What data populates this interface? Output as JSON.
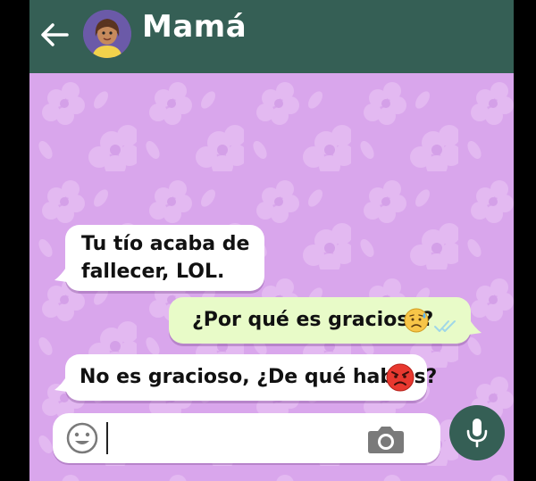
{
  "header": {
    "contact_name": "Mamá",
    "back_icon": "arrow-left-icon",
    "avatar_icon": "contact-avatar"
  },
  "messages": [
    {
      "direction": "incoming",
      "lines": [
        "Tu tío acaba de",
        "fallecer, LOL."
      ]
    },
    {
      "direction": "outgoing",
      "text": "¿Por qué es gracioso?",
      "emoji": "sad-sweat-face-emoji",
      "status_icon": "double-check-icon"
    },
    {
      "direction": "incoming",
      "text": "No es gracioso, ¿De qué hablas?",
      "emoji": "angry-face-emoji"
    }
  ],
  "composer": {
    "emoji_icon": "smiley-icon",
    "camera_icon": "camera-icon",
    "input_value": ""
  },
  "actions": {
    "mic_icon": "microphone-icon"
  },
  "colors": {
    "header": "#355f55",
    "chat_background": "#d9a6ec",
    "incoming_bubble": "#ffffff",
    "outgoing_bubble": "#e8fbc8",
    "mic_button": "#355f55"
  }
}
